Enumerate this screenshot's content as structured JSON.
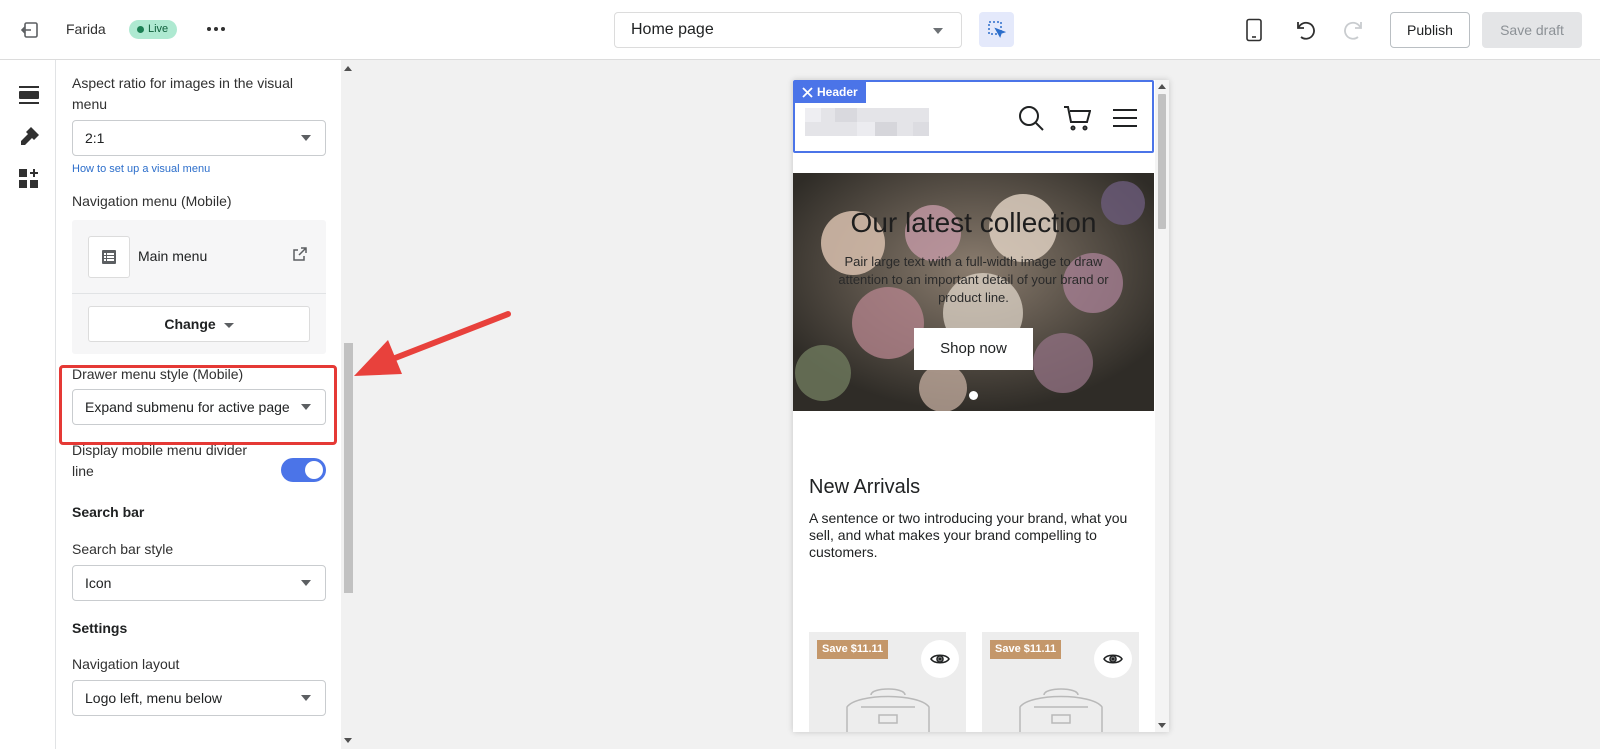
{
  "topbar": {
    "store_name": "Farida",
    "live_label": "Live",
    "page_selector": "Home page",
    "publish_label": "Publish",
    "save_label": "Save draft"
  },
  "rail": {
    "icons": [
      "sections-icon",
      "theme-settings-icon",
      "app-blocks-icon"
    ]
  },
  "panel": {
    "aspect_ratio_label": "Aspect ratio for images in the visual menu",
    "aspect_ratio_value": "2:1",
    "help_link": "How to set up a visual menu",
    "nav_menu_label": "Navigation menu (Mobile)",
    "nav_menu_name": "Main menu",
    "change_label": "Change",
    "drawer_style_label": "Drawer menu style (Mobile)",
    "drawer_style_value": "Expand submenu for active page",
    "divider_label": "Display mobile menu divider line",
    "divider_enabled": true,
    "search_heading": "Search bar",
    "search_style_label": "Search bar style",
    "search_style_value": "Icon",
    "settings_heading": "Settings",
    "nav_layout_label": "Navigation layout",
    "nav_layout_value": "Logo left, menu below"
  },
  "preview": {
    "header_tag": "Header",
    "hero_title": "Our latest collection",
    "hero_subtitle": "Pair large text with a full-width image to draw attention to an important detail of your brand or product line.",
    "shop_button": "Shop now",
    "new_arrivals_title": "New Arrivals",
    "new_arrivals_text": "A sentence or two introducing your brand, what you sell, and what makes your brand compelling to customers.",
    "products": [
      {
        "badge": "Save $11.11"
      },
      {
        "badge": "Save $11.11"
      }
    ]
  },
  "colors": {
    "accent": "#4b74e8",
    "annotation": "#e53935",
    "live_badge": "#aee9d1",
    "save_badge": "#c4976a"
  }
}
